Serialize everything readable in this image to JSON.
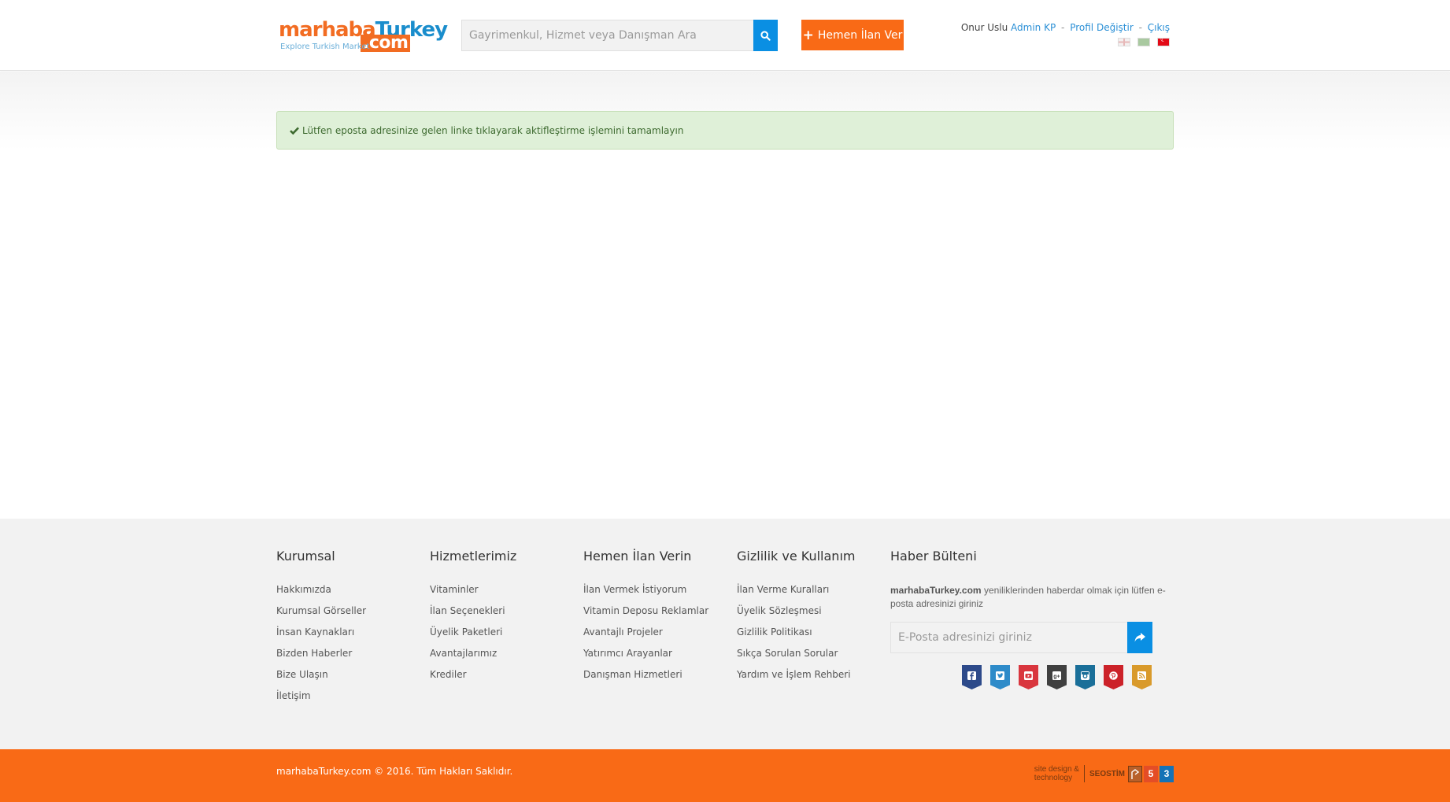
{
  "header": {
    "logo": {
      "word1": "marhaba",
      "word2": "Turkey",
      "domain": ".com",
      "tagline": "Explore Turkish Market"
    },
    "search": {
      "placeholder": "Gayrimenkul, Hizmet veya Danışman Ara",
      "icon": "search-icon"
    },
    "post_button": {
      "label": "Hemen İlan Ver",
      "icon": "plus"
    },
    "user": {
      "name": "Onur Uslu",
      "links": [
        "Admin KP",
        "Profil Değiştir",
        "Çıkış"
      ],
      "separator": "-"
    },
    "languages": [
      "en",
      "ar",
      "tr"
    ]
  },
  "alert": {
    "message": "Lütfen eposta adresinize gelen linke tıklayarak aktifleştirme işlemini tamamlayın",
    "icon": "check-icon"
  },
  "footer": {
    "columns": [
      {
        "title": "Kurumsal",
        "items": [
          "Hakkımızda",
          "Kurumsal Görseller",
          "İnsan Kaynakları",
          "Bizden Haberler",
          "Bize Ulaşın",
          "İletişim"
        ]
      },
      {
        "title": "Hizmetlerimiz",
        "items": [
          "Vitaminler",
          "İlan Seçenekleri",
          "Üyelik Paketleri",
          "Avantajlarımız",
          "Krediler"
        ]
      },
      {
        "title": "Hemen İlan Verin",
        "items": [
          "İlan Vermek İstiyorum",
          "Vitamin Deposu Reklamlar",
          "Avantajlı Projeler",
          "Yatırımcı Arayanlar",
          "Danışman Hizmetleri"
        ]
      },
      {
        "title": "Gizlilik ve Kullanım",
        "items": [
          "İlan Verme Kuralları",
          "Üyelik Sözleşmesi",
          "Gizlilik Politikası",
          "Sıkça Sorulan Sorular",
          "Yardım ve İşlem Rehberi"
        ]
      }
    ],
    "newsletter": {
      "title": "Haber Bülteni",
      "brand": "marhabaTurkey.com",
      "text": " yeniliklerinden haberdar olmak için lütfen e-posta adresinizi giriniz",
      "placeholder": "E-Posta adresinizi giriniz"
    },
    "socials": [
      {
        "name": "facebook",
        "color": "#2d4a8a"
      },
      {
        "name": "twitter",
        "color": "#2e8bc9"
      },
      {
        "name": "youtube",
        "color": "#d9363e"
      },
      {
        "name": "google-plus",
        "color": "#404040"
      },
      {
        "name": "instagram",
        "color": "#1a6f99"
      },
      {
        "name": "pinterest",
        "color": "#cc2229"
      },
      {
        "name": "rss",
        "color": "#d99a2b"
      }
    ],
    "copyright": "marhabaTurkey.com © 2016. Tüm Hakları Saklıdır.",
    "credit": {
      "line1": "site design &",
      "line2": "technology",
      "brand": "SEOSTİM",
      "html5": "5",
      "css3": "3"
    }
  },
  "colors": {
    "orange": "#f96a16",
    "blue": "#0a8fe3",
    "link_blue": "#2a8fd6",
    "alert_bg": "#dff0d8",
    "alert_text": "#3d6a2f",
    "footer_bg": "#f2f2f2"
  }
}
